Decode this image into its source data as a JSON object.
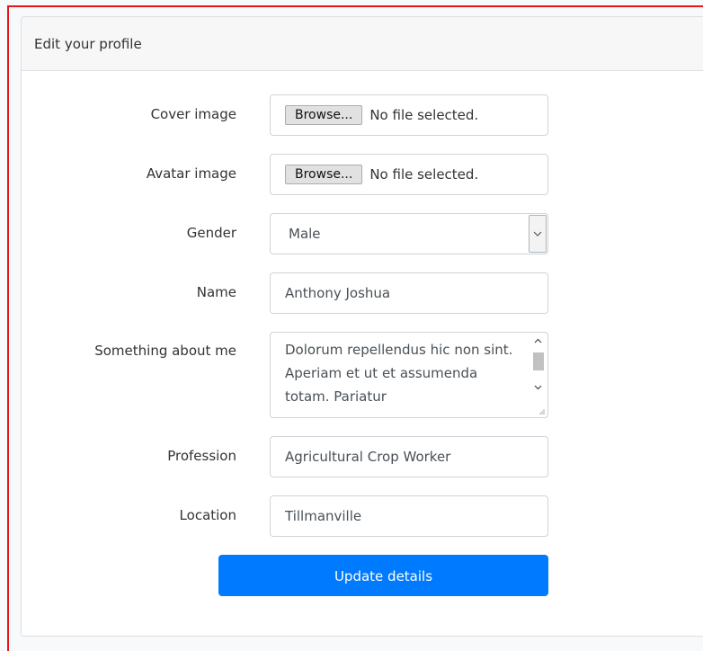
{
  "card": {
    "title": "Edit your profile"
  },
  "form": {
    "cover_image": {
      "label": "Cover image",
      "button": "Browse...",
      "status": "No file selected."
    },
    "avatar_image": {
      "label": "Avatar image",
      "button": "Browse...",
      "status": "No file selected."
    },
    "gender": {
      "label": "Gender",
      "selected": "Male"
    },
    "name": {
      "label": "Name",
      "value": "Anthony Joshua"
    },
    "about": {
      "label": "Something about me",
      "value": "Dolorum repellendus hic non sint. Aperiam et ut et assumenda totam. Pariatur"
    },
    "profession": {
      "label": "Profession",
      "value": "Agricultural Crop Worker"
    },
    "location": {
      "label": "Location",
      "value": "Tillmanville"
    },
    "submit_label": "Update details"
  },
  "colors": {
    "primary": "#007bff",
    "frame_accent": "#e8141c"
  }
}
